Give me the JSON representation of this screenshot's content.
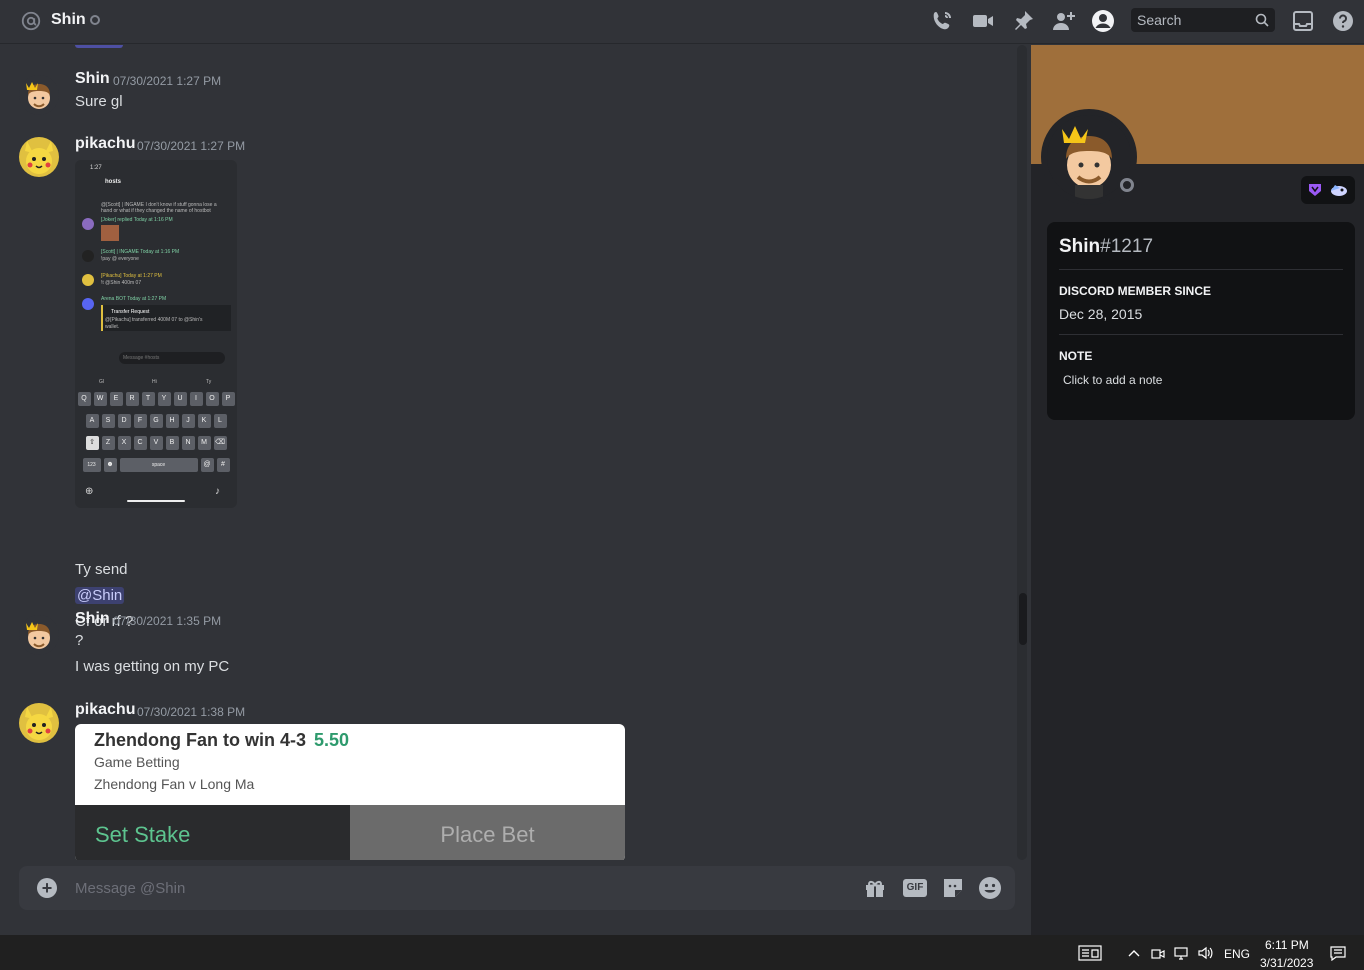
{
  "header": {
    "title": "Shin",
    "search_placeholder": "Search",
    "icons": [
      "phone-call-icon",
      "video-call-icon",
      "pin-icon",
      "add-friend-icon",
      "profile-toggle-icon",
      "search-icon",
      "inbox-icon",
      "help-icon"
    ]
  },
  "messages": [
    {
      "author": "Shin",
      "timestamp": "07/30/2021 1:27 PM",
      "lines": [
        "Sure gl"
      ]
    },
    {
      "author": "pikachu",
      "timestamp": "07/30/2021 1:27 PM",
      "lines": [
        "Ty send",
        "@Shin",
        "Cf or rf ?"
      ],
      "attachment": {
        "status_time": "1:27",
        "channel": "hosts",
        "chat": [
          "@[Scott] | INGAME  I don't know if stuff gonna lose a",
          "hand or what if they changed the name of hostbot",
          "[Joker]  replied  Today at 1:16 PM",
          "[Scott] | INGAME  Today at 1:16 PM",
          "!pay @ everyone",
          "[Pikachu]  Today at 1:27 PM",
          "!t @Shin 400m 07",
          "Arena  BOT  Today at 1:27 PM",
          "Transfer Request",
          "@[Pikachu] transferred 400M 07 to @Shin's",
          "wallet."
        ],
        "message_placeholder": "Message #hosts",
        "suggestions": [
          "Gl",
          "Hi",
          "Ty"
        ],
        "keyboard_rows": [
          [
            "Q",
            "W",
            "E",
            "R",
            "T",
            "Y",
            "U",
            "I",
            "O",
            "P"
          ],
          [
            "A",
            "S",
            "D",
            "F",
            "G",
            "H",
            "J",
            "K",
            "L"
          ],
          [
            "Z",
            "X",
            "C",
            "V",
            "B",
            "N",
            "M"
          ]
        ],
        "numbers_key": "123",
        "space_key": "space",
        "at_key": "@",
        "hash_key": "#"
      }
    },
    {
      "author": "Shin",
      "timestamp": "07/30/2021 1:35 PM",
      "lines": [
        "?",
        "I was getting on my PC"
      ]
    },
    {
      "author": "pikachu",
      "timestamp": "07/30/2021 1:38 PM",
      "lines": [],
      "embed": {
        "title": "Zhendong Fan to win 4-3",
        "odds": "5.50",
        "type": "Game Betting",
        "match": "Zhendong Fan v Long Ma",
        "stake_label": "Set Stake",
        "place_label": "Place Bet"
      }
    }
  ],
  "composer": {
    "placeholder": "Message @Shin",
    "gif_label": "GIF"
  },
  "profile": {
    "username": "Shin",
    "discriminator": "#1217",
    "member_since_heading": "DISCORD MEMBER SINCE",
    "member_since": "Dec 28, 2015",
    "note_heading": "NOTE",
    "note_placeholder": "Click to add a note",
    "banner_color": "#9f6f3b"
  },
  "taskbar": {
    "language": "ENG",
    "time": "6:11 PM",
    "date": "3/31/2023"
  }
}
